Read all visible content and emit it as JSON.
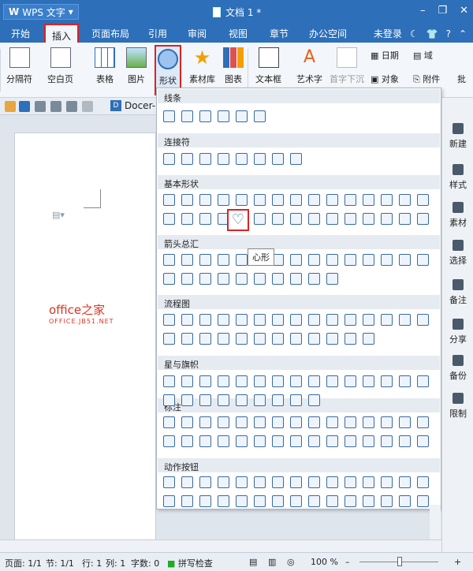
{
  "titlebar": {
    "app": "WPS 文字",
    "doc_title": "文档 1 *"
  },
  "menu": {
    "items": [
      "开始",
      "插入",
      "页面布局",
      "引用",
      "审阅",
      "视图",
      "章节",
      "办公空间"
    ],
    "active": "插入",
    "login": "未登录"
  },
  "ribbon": {
    "buttons": [
      "分隔符",
      "空白页",
      "表格",
      "图片",
      "形状",
      "素材库",
      "图表",
      "文本框",
      "艺术字",
      "首字下沉",
      "日期",
      "对象",
      "域",
      "附件"
    ],
    "cut": "批"
  },
  "toolbar2": {
    "docer": "Docer-"
  },
  "sidebar": {
    "items": [
      "新建",
      "样式",
      "素材",
      "选择",
      "备注",
      "分享",
      "备份",
      "限制"
    ]
  },
  "panel": {
    "sections": [
      "线条",
      "连接符",
      "基本形状",
      "箭头总汇",
      "流程图",
      "星与旗帜",
      "标注",
      "动作按钮"
    ],
    "tooltip": "心形"
  },
  "brand": {
    "line1": "office之家",
    "line2": "OFFICE.JB51.NET"
  },
  "status": {
    "page": "页面: 1/1",
    "section": "节: 1/1",
    "row": "行: 1",
    "col": "列: 1",
    "words": "字数: 0",
    "spell": "拼写检查",
    "zoom": "100 %"
  },
  "colors": {
    "accent": "#2d6fb8",
    "highlight": "#dd2222"
  }
}
